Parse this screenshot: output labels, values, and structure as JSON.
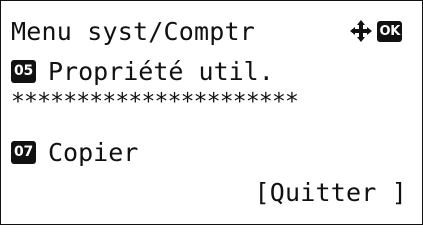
{
  "screen": {
    "title": "Menu syst/Comptr",
    "nav_icon": "four-way-arrow-icon",
    "ok_badge": "OK",
    "items": [
      {
        "number": "05",
        "label": "Propriété util."
      },
      {
        "number": "07",
        "label": "Copier"
      }
    ],
    "separator": "**********************",
    "softkey_right": "[Quitter ]"
  }
}
